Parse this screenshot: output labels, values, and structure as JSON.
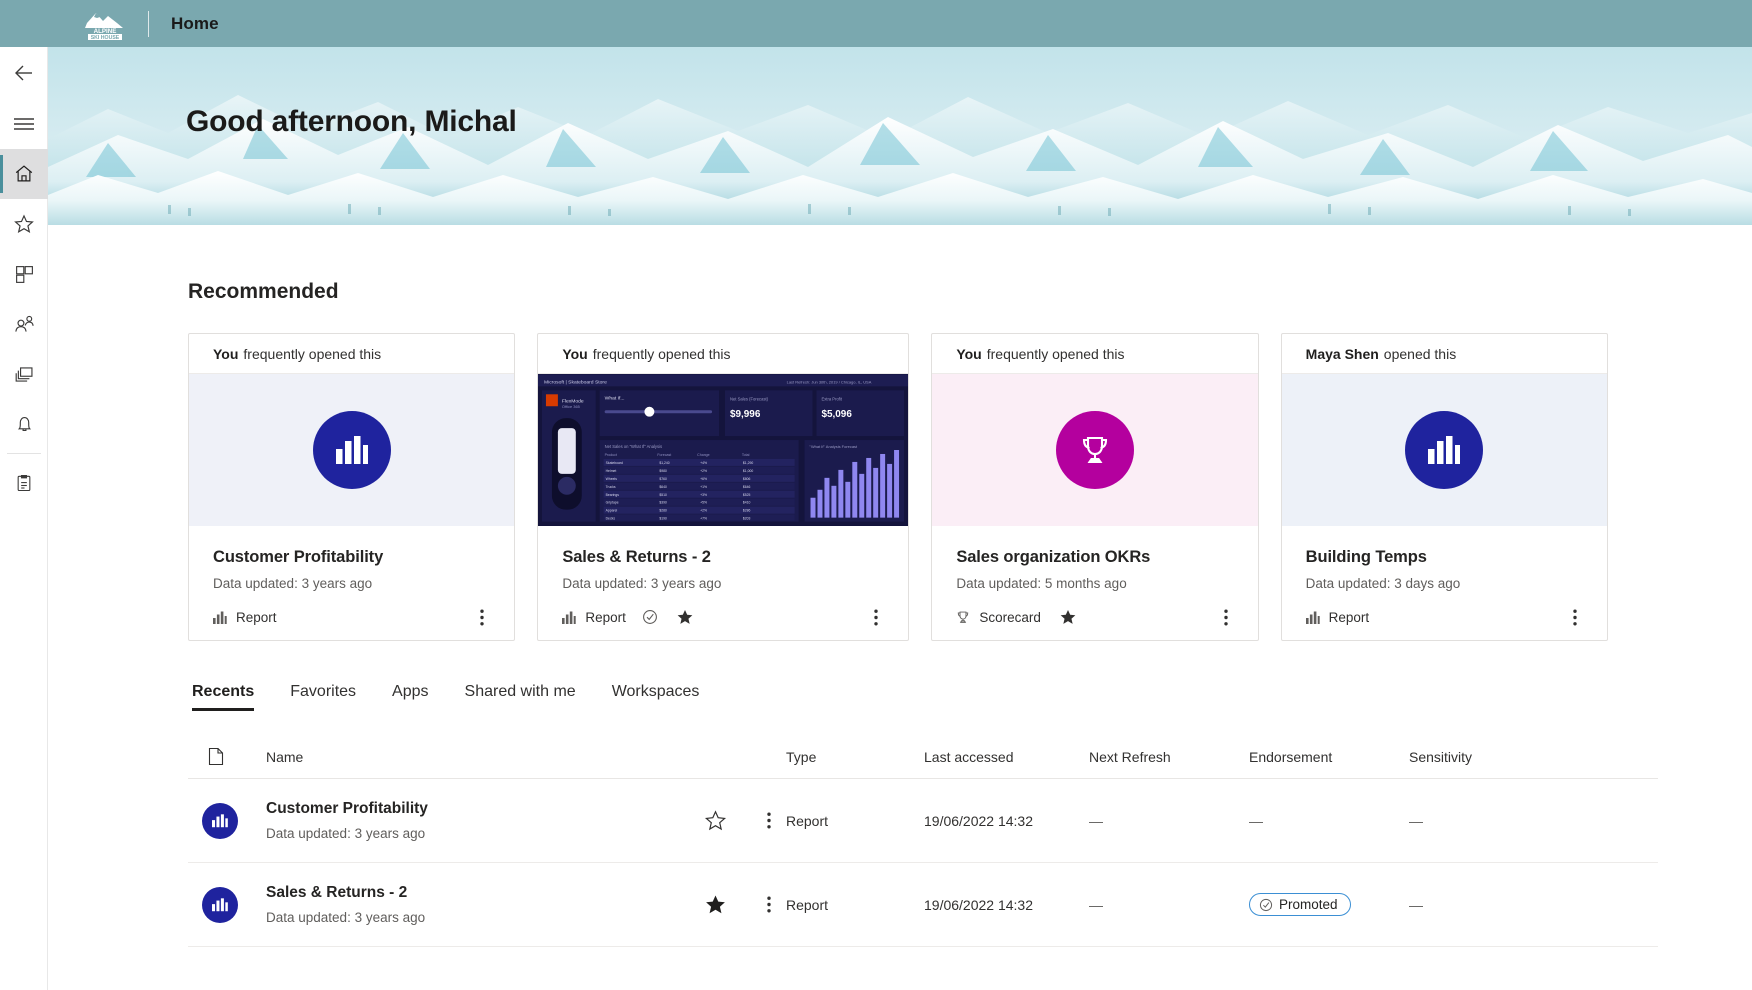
{
  "topbar": {
    "brand_line1": "ALPINE",
    "brand_line2": "SKI HOUSE",
    "title": "Home"
  },
  "rail": {
    "items": [
      {
        "name": "back-arrow-icon",
        "label": "Back"
      },
      {
        "name": "hamburger-icon",
        "label": "Show navigation"
      },
      {
        "name": "home-icon",
        "label": "Home"
      },
      {
        "name": "star-icon",
        "label": "Favorites"
      },
      {
        "name": "apps-grid-icon",
        "label": "Apps"
      },
      {
        "name": "people-icon",
        "label": "Shared with me"
      },
      {
        "name": "workspaces-icon",
        "label": "Workspaces"
      },
      {
        "name": "bell-icon",
        "label": "Notifications"
      },
      {
        "name": "metrics-icon",
        "label": "Metrics"
      }
    ]
  },
  "hero": {
    "greeting": "Good afternoon, Michal"
  },
  "main": {
    "recommended_title": "Recommended",
    "cards": [
      {
        "actor": "You",
        "action": "frequently opened this",
        "title": "Customer Profitability",
        "subtitle": "Data updated: 3 years ago",
        "type_label": "Report",
        "type_icon": "bar-chart-icon",
        "thumb": "badge-navy-bar-chart",
        "endorsed": false,
        "favorite": false,
        "kebab": "more-options-icon"
      },
      {
        "actor": "You",
        "action": "frequently opened this",
        "title": "Sales & Returns  - 2",
        "subtitle": "Data updated: 3 years ago",
        "type_label": "Report",
        "type_icon": "bar-chart-icon",
        "thumb": "report-preview-image",
        "endorsed": true,
        "favorite": true,
        "kebab": "more-options-icon"
      },
      {
        "actor": "You",
        "action": "frequently opened this",
        "title": "Sales organization OKRs",
        "subtitle": "Data updated: 5 months ago",
        "type_label": "Scorecard",
        "type_icon": "trophy-icon",
        "thumb": "badge-magenta-trophy",
        "endorsed": false,
        "favorite": true,
        "kebab": "more-options-icon"
      },
      {
        "actor": "Maya Shen",
        "action": "opened this",
        "title": "Building Temps",
        "subtitle": "Data updated: 3 days ago",
        "type_label": "Report",
        "type_icon": "bar-chart-icon",
        "thumb": "badge-navy-bar-chart",
        "endorsed": false,
        "favorite": false,
        "kebab": "more-options-icon"
      }
    ],
    "tabs": [
      {
        "label": "Recents",
        "active": true
      },
      {
        "label": "Favorites",
        "active": false
      },
      {
        "label": "Apps",
        "active": false
      },
      {
        "label": "Shared with me",
        "active": false
      },
      {
        "label": "Workspaces",
        "active": false
      }
    ],
    "table": {
      "columns": {
        "doc_icon": "document-icon",
        "name": "Name",
        "type": "Type",
        "last_accessed": "Last accessed",
        "next_refresh": "Next Refresh",
        "endorsement": "Endorsement",
        "sensitivity": "Sensitivity"
      },
      "rows": [
        {
          "name": "Customer Profitability",
          "sub": "Data updated: 3 years ago",
          "favorite": false,
          "type": "Report",
          "last_accessed": "19/06/2022 14:32",
          "next_refresh": "—",
          "endorsement": "—",
          "endorsement_badge": false,
          "sensitivity": "—"
        },
        {
          "name": "Sales & Returns  - 2",
          "sub": "Data updated: 3 years ago",
          "favorite": true,
          "type": "Report",
          "last_accessed": "19/06/2022 14:32",
          "next_refresh": "—",
          "endorsement": "Promoted",
          "endorsement_badge": true,
          "sensitivity": "—"
        }
      ]
    }
  },
  "colors": {
    "topbar": "#7aa8af",
    "badge_navy": "#1f239e",
    "badge_magenta": "#b4009e",
    "promoted_border": "#3b8fd4",
    "rail_selected": "#dededf"
  }
}
